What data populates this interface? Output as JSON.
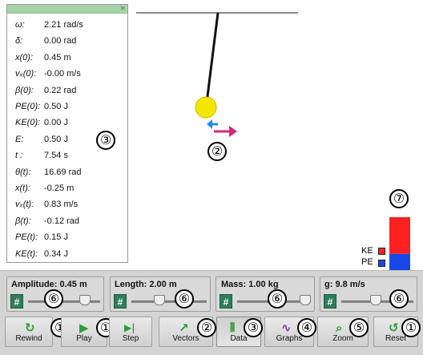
{
  "data_panel": {
    "close_glyph": "×",
    "rows": [
      {
        "label": "ω:",
        "value": "2.21 rad/s"
      },
      {
        "label": "δ:",
        "value": "0.00 rad"
      },
      {
        "label": "x(0):",
        "value": "0.45 m"
      },
      {
        "label": "vₓ(0):",
        "value": "-0.00 m/s"
      },
      {
        "label": "β(0):",
        "value": "0.22 rad"
      },
      {
        "label": "PE(0):",
        "value": "0.50 J"
      },
      {
        "label": "KE(0):",
        "value": "0.00 J"
      },
      {
        "label": "E:",
        "value": "0.50 J"
      },
      {
        "label": "t :",
        "value": "7.54 s"
      },
      {
        "label": "θ(t):",
        "value": "16.69 rad"
      },
      {
        "label": "x(t):",
        "value": "-0.25 m"
      },
      {
        "label": "vₓ(t):",
        "value": "0.83 m/s"
      },
      {
        "label": "β(t):",
        "value": "-0.12 rad"
      },
      {
        "label": "PE(t):",
        "value": "0.15 J"
      },
      {
        "label": "KE(t):",
        "value": "0.34 J"
      }
    ]
  },
  "callouts": {
    "data_panel": "③",
    "vectors_on_stage": "②",
    "energy": "⑦",
    "slider": "⑥",
    "rewind": "①",
    "play": "①",
    "vectors": "②",
    "data": "③",
    "graphs": "④",
    "zoom": "⑤",
    "reset": "①"
  },
  "colors": {
    "bob": "#f5e600",
    "string": "#111111",
    "ke_bar": "#ff2020",
    "pe_bar": "#1848e6",
    "velocity_arrow": "#d8287a",
    "accel_arrow": "#1e8fe0"
  },
  "energy_legend": {
    "ke_label": "KE",
    "pe_label": "PE",
    "ke_value": 0.34,
    "pe_value": 0.15
  },
  "sliders": [
    {
      "label": "Amplitude: 0.45 m",
      "hash": "#",
      "callout": "⑥"
    },
    {
      "label": "Length: 2.00 m",
      "hash": "#",
      "callout": "⑥"
    },
    {
      "label": "Mass: 1.00 kg",
      "hash": "#",
      "callout": "⑥"
    },
    {
      "label": "g: 9.8 m/s",
      "hash": "#",
      "callout": "⑥"
    }
  ],
  "buttons": {
    "rewind": {
      "label": "Rewind",
      "icon": "↻"
    },
    "play": {
      "label": "Play",
      "icon": "▶"
    },
    "step": {
      "label": "Step",
      "icon": "▶|"
    },
    "vectors": {
      "label": "Vectors",
      "icon": "↗"
    },
    "data": {
      "label": "Data",
      "icon": "⫴"
    },
    "graphs": {
      "label": "Graphs",
      "icon": "∿"
    },
    "zoom": {
      "label": "Zoom",
      "icon": "⌕"
    },
    "reset": {
      "label": "Reset",
      "icon": "↺"
    }
  }
}
